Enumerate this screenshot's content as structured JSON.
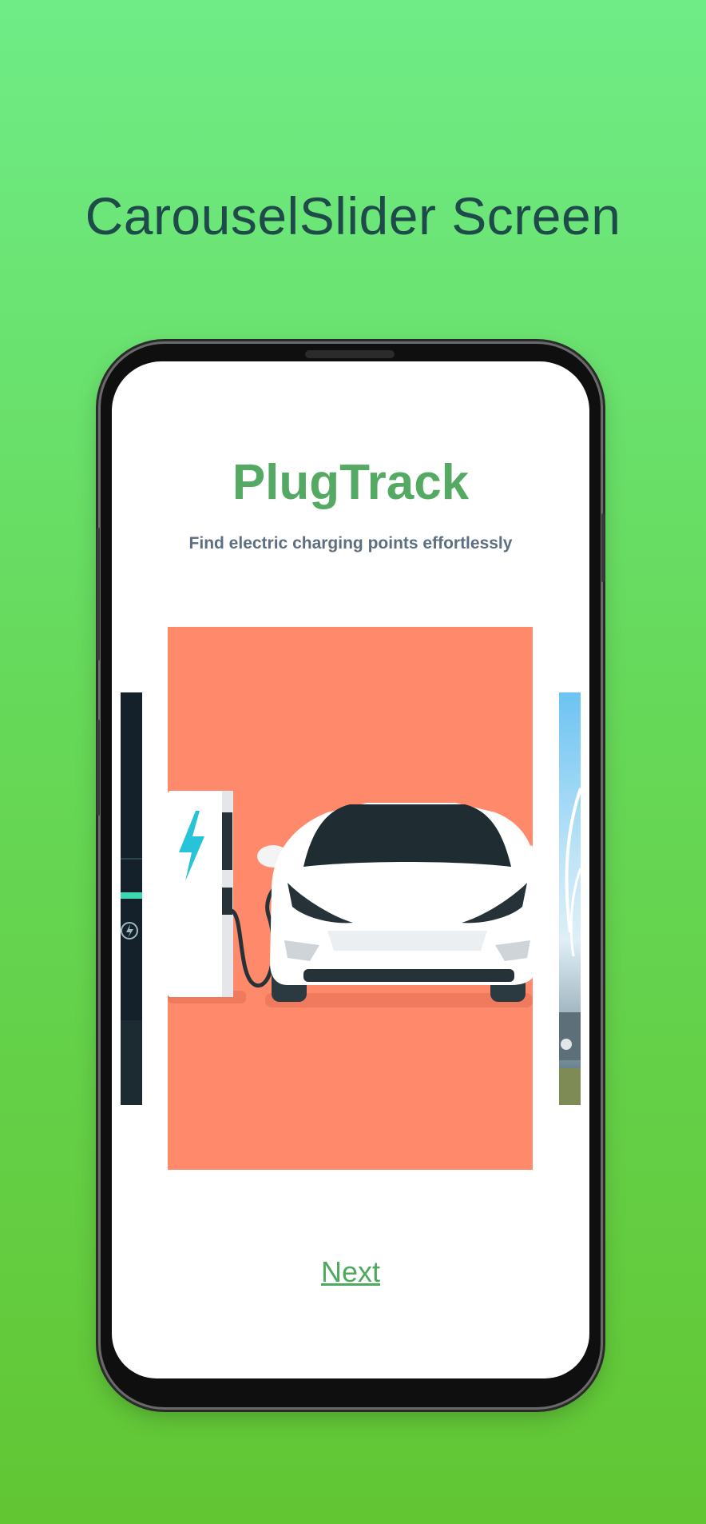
{
  "poster": {
    "title": "CarouselSlider Screen"
  },
  "app": {
    "title": "PlugTrack",
    "subtitle": "Find electric charging points effortlessly",
    "next_label": "Next"
  },
  "carousel": {
    "slides": [
      {
        "name": "dark-charging-station"
      },
      {
        "name": "white-car-at-charging-station"
      },
      {
        "name": "sky-landscape"
      }
    ],
    "active_index": 1
  },
  "colors": {
    "background_top": "#6fec86",
    "background_bottom": "#62c633",
    "brand_green": "#54aa63",
    "slide_bg": "#fe8a6b"
  }
}
